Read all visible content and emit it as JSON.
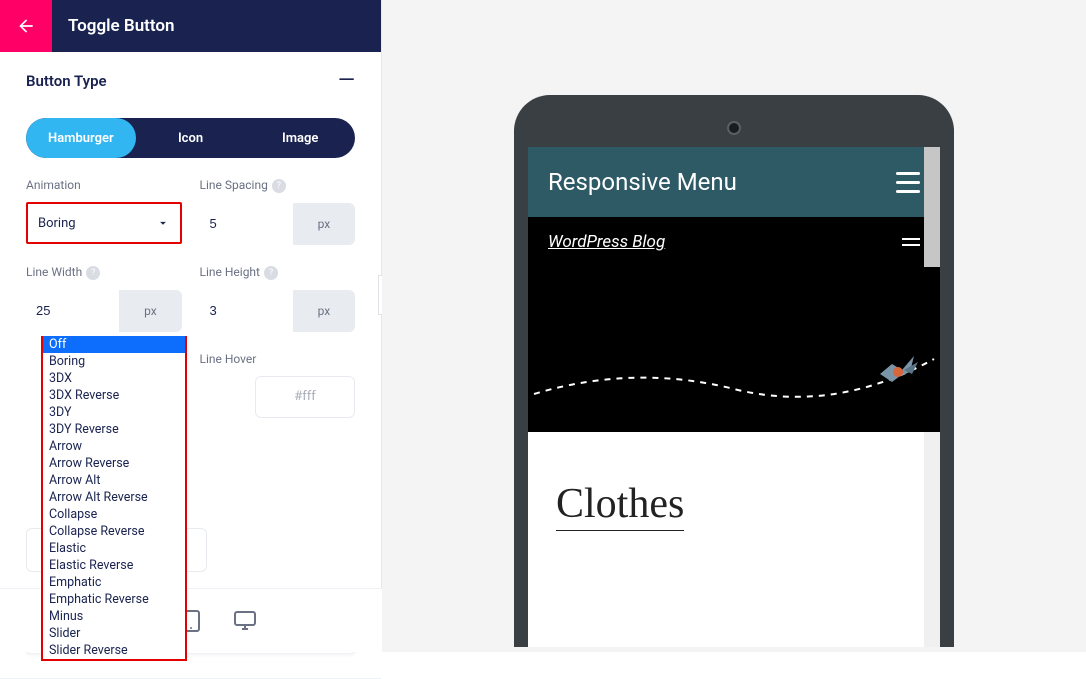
{
  "header": {
    "title": "Toggle Button"
  },
  "section": {
    "button_type": {
      "title": "Button Type",
      "toggle_icon": "—"
    },
    "segments": {
      "hamburger": "Hamburger",
      "icon": "Icon",
      "image": "Image",
      "active": "hamburger"
    }
  },
  "fields": {
    "animation": {
      "label": "Animation",
      "value": "Boring"
    },
    "line_spacing": {
      "label": "Line Spacing",
      "value": "5",
      "unit": "px"
    },
    "line_width": {
      "label": "Line Width",
      "value": "25",
      "unit": "px"
    },
    "line_height": {
      "label": "Line Height",
      "value": "3",
      "unit": "px"
    },
    "line_hover": {
      "label": "Line Hover",
      "placeholder": "#fff"
    }
  },
  "animation_options": [
    "Off",
    "Boring",
    "3DX",
    "3DX Reverse",
    "3DY",
    "3DY Reverse",
    "Arrow",
    "Arrow Reverse",
    "Arrow Alt",
    "Arrow Alt Reverse",
    "Collapse",
    "Collapse Reverse",
    "Elastic",
    "Elastic Reverse",
    "Emphatic",
    "Emphatic Reverse",
    "Minus",
    "Slider",
    "Slider Reverse"
  ],
  "animation_selected": "Off",
  "collapsed_section_icon": "+",
  "preview": {
    "responsive_menu_title": "Responsive Menu",
    "wp_blog_title": "WordPress Blog",
    "content_heading": "Clothes"
  }
}
